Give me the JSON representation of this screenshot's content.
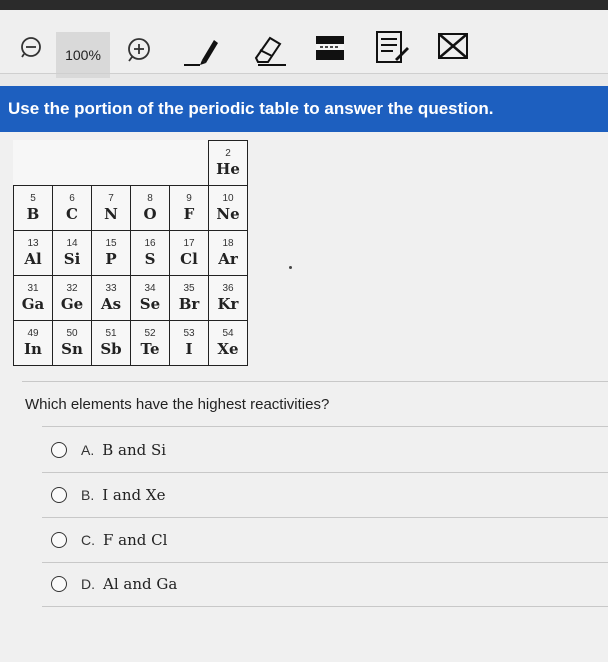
{
  "toolbar": {
    "zoom_value": "100%",
    "icons": [
      "zoom-out-icon",
      "zoom-in-icon",
      "pencil-icon",
      "eraser-icon",
      "line-reader-icon",
      "notepad-icon",
      "eliminate-choice-icon"
    ]
  },
  "banner": {
    "text": "Use the portion of the periodic table to answer the question."
  },
  "periodic_table": {
    "rows": [
      [
        null,
        null,
        null,
        null,
        null,
        {
          "num": "2",
          "sym": "He"
        }
      ],
      [
        {
          "num": "5",
          "sym": "B"
        },
        {
          "num": "6",
          "sym": "C"
        },
        {
          "num": "7",
          "sym": "N"
        },
        {
          "num": "8",
          "sym": "O"
        },
        {
          "num": "9",
          "sym": "F"
        },
        {
          "num": "10",
          "sym": "Ne"
        }
      ],
      [
        {
          "num": "13",
          "sym": "Al"
        },
        {
          "num": "14",
          "sym": "Si"
        },
        {
          "num": "15",
          "sym": "P"
        },
        {
          "num": "16",
          "sym": "S"
        },
        {
          "num": "17",
          "sym": "Cl"
        },
        {
          "num": "18",
          "sym": "Ar"
        }
      ],
      [
        {
          "num": "31",
          "sym": "Ga"
        },
        {
          "num": "32",
          "sym": "Ge"
        },
        {
          "num": "33",
          "sym": "As"
        },
        {
          "num": "34",
          "sym": "Se"
        },
        {
          "num": "35",
          "sym": "Br"
        },
        {
          "num": "36",
          "sym": "Kr"
        }
      ],
      [
        {
          "num": "49",
          "sym": "In"
        },
        {
          "num": "50",
          "sym": "Sn"
        },
        {
          "num": "51",
          "sym": "Sb"
        },
        {
          "num": "52",
          "sym": "Te"
        },
        {
          "num": "53",
          "sym": "I"
        },
        {
          "num": "54",
          "sym": "Xe"
        }
      ]
    ]
  },
  "question": {
    "text": "Which elements have the highest reactivities?"
  },
  "options": [
    {
      "letter": "A.",
      "text": "B and Si"
    },
    {
      "letter": "B.",
      "text": "I and Xe"
    },
    {
      "letter": "C.",
      "text": "F and Cl"
    },
    {
      "letter": "D.",
      "text": "Al and Ga"
    }
  ],
  "colors": {
    "banner": "#1d5fbf",
    "background": "#f0f0f0"
  }
}
